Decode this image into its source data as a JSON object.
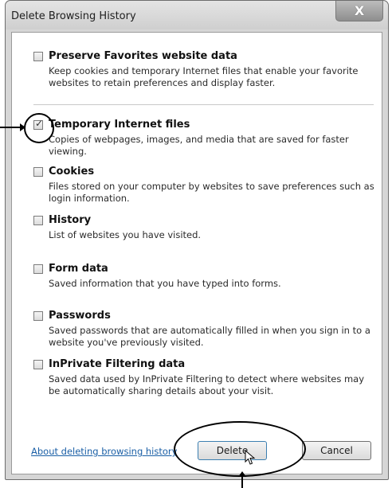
{
  "window": {
    "title": "Delete Browsing History",
    "close_glyph": "X"
  },
  "options": [
    {
      "label": "Preserve Favorites website data",
      "description": "Keep cookies and temporary Internet files that enable your favorite websites to retain preferences and display faster.",
      "checked": false
    },
    {
      "label": "Temporary Internet files",
      "description": "Copies of webpages, images, and media that are saved for faster viewing.",
      "checked": true
    },
    {
      "label": "Cookies",
      "description": "Files stored on your computer by websites to save preferences such as login information.",
      "checked": false
    },
    {
      "label": "History",
      "description": "List of websites you have visited.",
      "checked": false
    },
    {
      "label": "Form data",
      "description": "Saved information that you have typed into forms.",
      "checked": false
    },
    {
      "label": "Passwords",
      "description": "Saved passwords that are automatically filled in when you sign in to a website you've previously visited.",
      "checked": false
    },
    {
      "label": "InPrivate Filtering data",
      "description": "Saved data used by InPrivate Filtering to detect where websites may be automatically sharing details about your visit.",
      "checked": false
    }
  ],
  "footer": {
    "about_link": "About deleting browsing history",
    "delete_label": "Delete",
    "cancel_label": "Cancel"
  },
  "icons": {
    "checkbox_tick": "check-icon",
    "close": "close-icon",
    "cursor": "pointer-cursor-icon"
  },
  "colors": {
    "link": "#1a5fa6",
    "delete_border": "#3c7fb1"
  }
}
